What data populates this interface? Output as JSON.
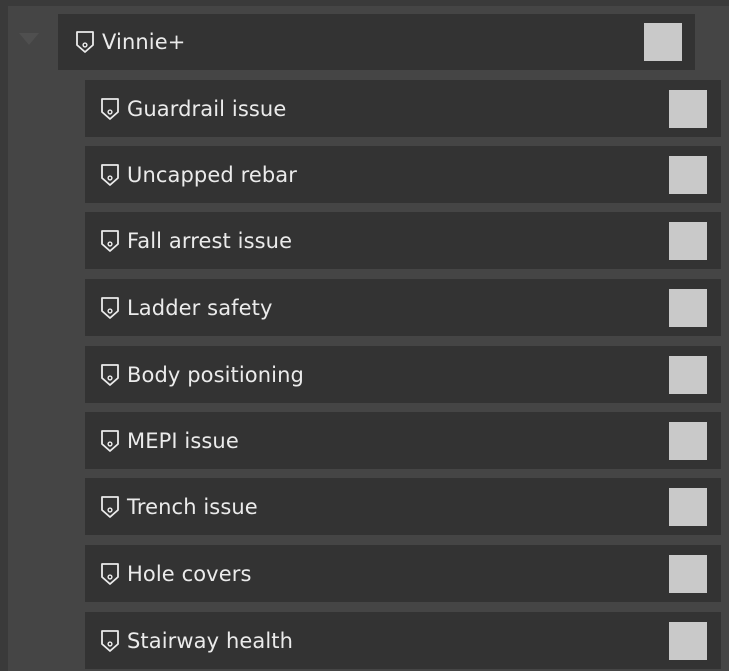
{
  "tree": {
    "parent": {
      "label": "Vinnie+",
      "expanded": true,
      "icon": "tag-icon"
    },
    "children": [
      {
        "label": "Guardrail issue",
        "icon": "tag-icon"
      },
      {
        "label": "Uncapped rebar",
        "icon": "tag-icon"
      },
      {
        "label": "Fall arrest issue",
        "icon": "tag-icon"
      },
      {
        "label": "Ladder safety",
        "icon": "tag-icon"
      },
      {
        "label": "Body positioning",
        "icon": "tag-icon"
      },
      {
        "label": "MEPI issue",
        "icon": "tag-icon"
      },
      {
        "label": "Trench issue",
        "icon": "tag-icon"
      },
      {
        "label": "Hole covers",
        "icon": "tag-icon"
      },
      {
        "label": "Stairway health",
        "icon": "tag-icon"
      }
    ]
  },
  "colors": {
    "background": "#3a3a3a",
    "panel": "#454545",
    "row": "#333333",
    "text": "#ebebeb",
    "checkbox": "#c9c9c9",
    "expander": "#4f4f4f"
  }
}
